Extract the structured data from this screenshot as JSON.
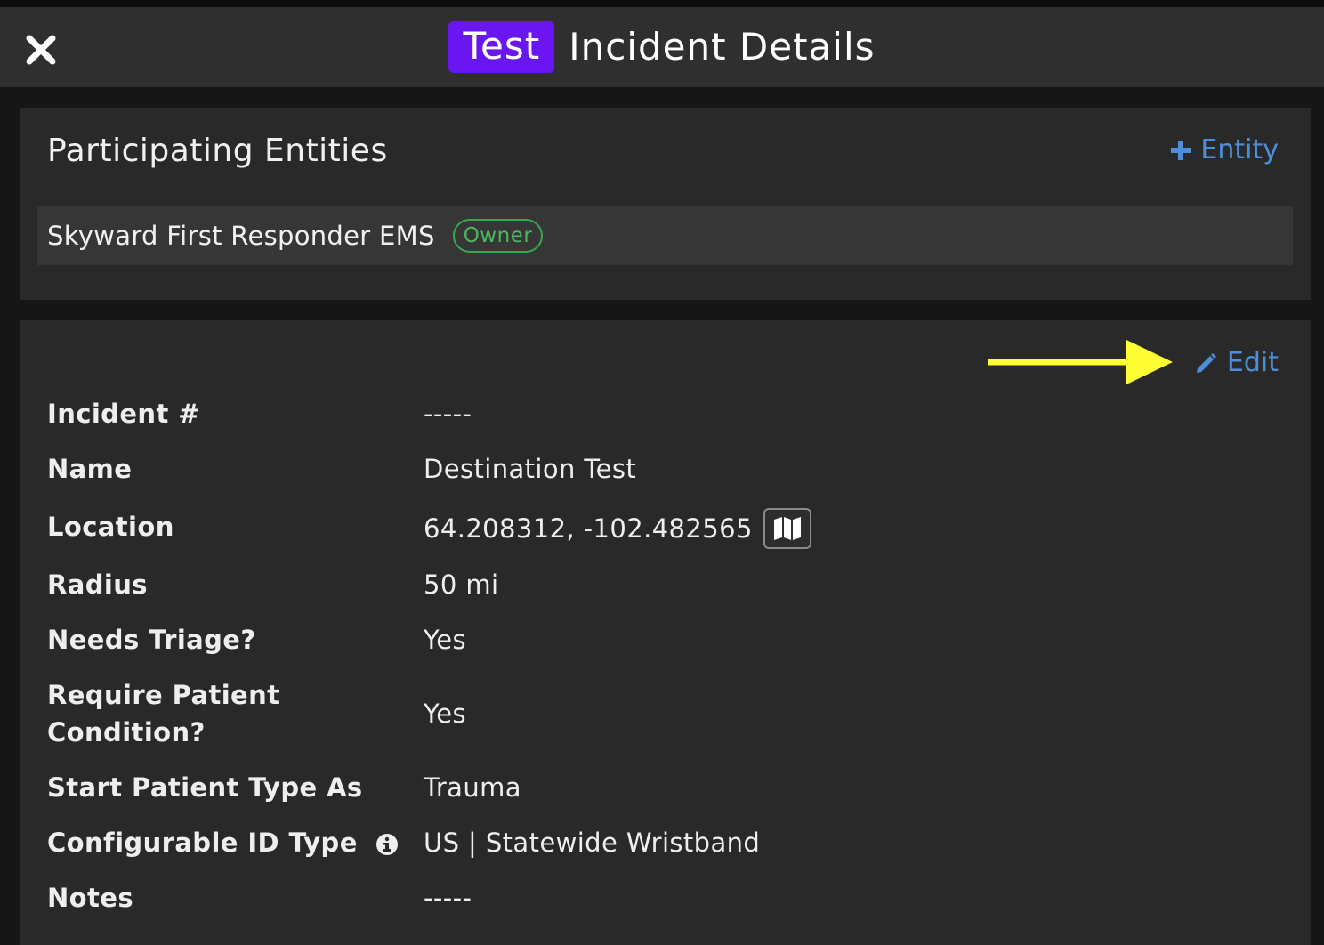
{
  "header": {
    "badge": "Test",
    "title": "Incident Details"
  },
  "entities_card": {
    "title": "Participating Entities",
    "add_label": "Entity",
    "items": [
      {
        "name": "Skyward First Responder EMS",
        "role": "Owner"
      }
    ]
  },
  "details_card": {
    "edit_label": "Edit",
    "rows": [
      {
        "label": "Incident #",
        "value": "-----"
      },
      {
        "label": "Name",
        "value": "Destination Test"
      },
      {
        "label": "Location",
        "value": "64.208312, -102.482565"
      },
      {
        "label": "Radius",
        "value": "50 mi"
      },
      {
        "label": "Needs Triage?",
        "value": "Yes"
      },
      {
        "label_line1": "Require Patient",
        "label_line2": "Condition?",
        "value": "Yes"
      },
      {
        "label": "Start Patient Type As",
        "value": "Trauma"
      },
      {
        "label": "Configurable ID Type",
        "value": "US | Statewide Wristband"
      },
      {
        "label": "Notes",
        "value": "-----"
      }
    ]
  },
  "colors": {
    "accent_purple": "#6a16f0",
    "link_blue": "#4d8ed8",
    "owner_green": "#3aa64b",
    "annotation_arrow": "#ffff33"
  },
  "icons": [
    "close-icon",
    "plus-icon",
    "pencil-icon",
    "map-icon",
    "info-icon",
    "annotation-arrow"
  ]
}
